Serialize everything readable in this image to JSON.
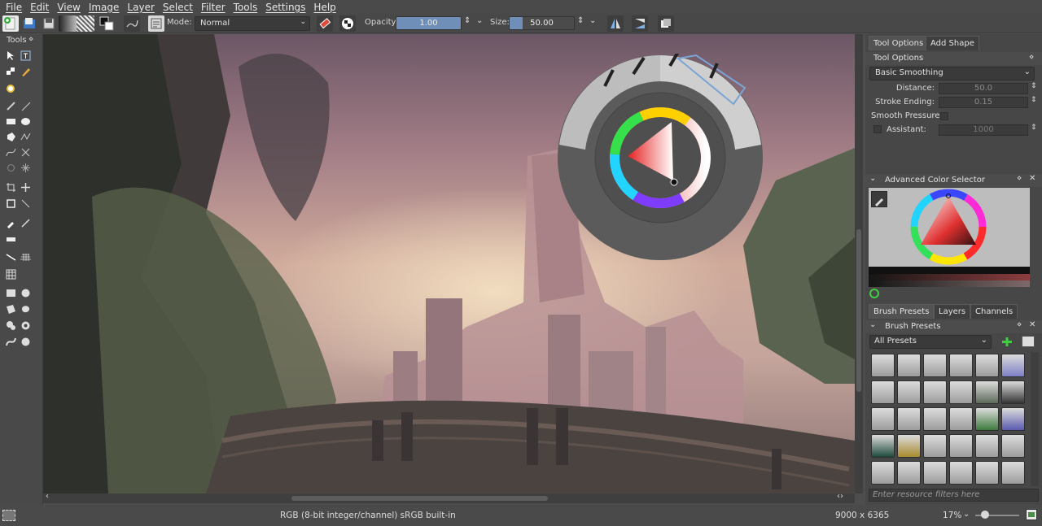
{
  "menu": [
    "File",
    "Edit",
    "View",
    "Image",
    "Layer",
    "Select",
    "Filter",
    "Tools",
    "Settings",
    "Help"
  ],
  "toolbar": {
    "mode_label": "Mode:",
    "mode_value": "Normal",
    "opacity_label": "Opacity:",
    "opacity_value": "1.00",
    "opacity_fraction": 1.0,
    "size_label": "Size:",
    "size_value": "50.00",
    "size_fraction": 0.2
  },
  "toolbox": {
    "title": "Tools"
  },
  "right": {
    "tabs_top": [
      "Tool Options",
      "Add Shape"
    ],
    "tool_options": {
      "title": "Tool Options",
      "smoothing": "Basic Smoothing",
      "distance_label": "Distance:",
      "distance_value": "50.0",
      "stroke_ending_label": "Stroke Ending:",
      "stroke_ending_value": "0.15",
      "smooth_pressure_label": "Smooth Pressure",
      "assistant_label": "Assistant:",
      "assistant_value": "1000"
    },
    "color_selector": {
      "title": "Advanced Color Selector"
    },
    "tabs_bottom": [
      "Brush Presets",
      "Layers",
      "Channels"
    ],
    "brush_presets": {
      "title": "Brush Presets",
      "filter_value": "All Presets",
      "search_placeholder": "Enter resource filters here"
    }
  },
  "status": {
    "color_space": "RGB (8-bit integer/channel)  sRGB built-in",
    "dimensions": "9000 x 6365",
    "zoom": "17%"
  },
  "colors": {
    "accent": "#6f8fb9",
    "panel": "#474747",
    "menubar": "#4a4a4a"
  }
}
